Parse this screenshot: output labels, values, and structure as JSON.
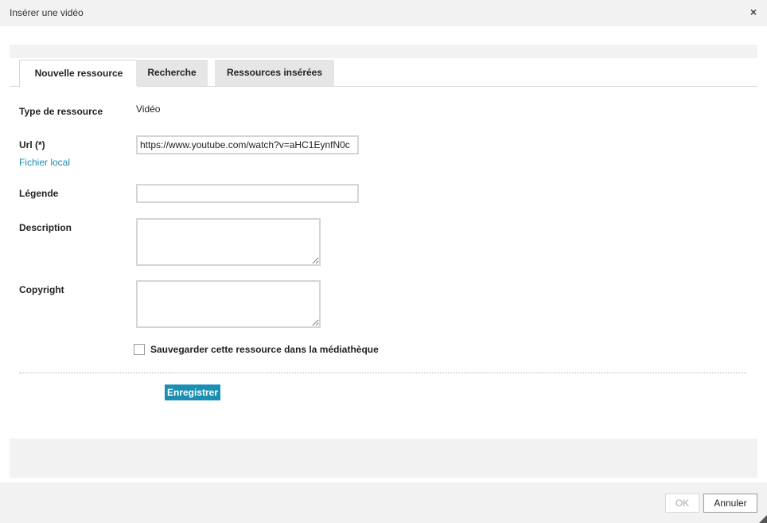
{
  "dialog": {
    "title": "Insérer une vidéo",
    "close_icon": "close-icon"
  },
  "tabs": [
    {
      "label": "Nouvelle ressource",
      "active": true
    },
    {
      "label": "Recherche",
      "active": false
    },
    {
      "label": "Ressources insérées",
      "active": false
    }
  ],
  "form": {
    "type_label": "Type de ressource",
    "type_value": "Vidéo",
    "url_label": "Url (*)",
    "url_value": "https://www.youtube.com/watch?v=aHC1EynfN0c",
    "local_file_link": "Fichier local",
    "caption_label": "Légende",
    "caption_value": "",
    "description_label": "Description",
    "description_value": "",
    "copyright_label": "Copyright",
    "copyright_value": "",
    "save_to_library_label": "Sauvegarder cette ressource dans la médiathèque",
    "save_to_library_checked": false,
    "save_button": "Enregistrer"
  },
  "footer": {
    "ok_label": "OK",
    "ok_enabled": false,
    "cancel_label": "Annuler"
  },
  "colors": {
    "accent": "#1a8fb3",
    "panel_gray": "#f2f2f2",
    "tab_inactive": "#e6e6e6"
  }
}
